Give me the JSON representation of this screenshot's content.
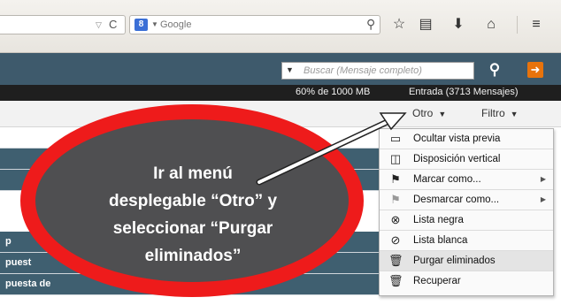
{
  "browser": {
    "search_placeholder": "Google",
    "search_engine_badge": "8",
    "icons": [
      "reload-icon",
      "search-icon",
      "star-icon",
      "reading-list-icon",
      "download-icon",
      "home-icon",
      "menu-icon"
    ]
  },
  "header": {
    "search_placeholder": "Buscar (Mensaje completo)"
  },
  "status": {
    "quota": "60% de 1000 MB",
    "folder": "Entrada (3713 Mensajes)"
  },
  "actions": {
    "otro": "Otro",
    "filtro": "Filtro"
  },
  "list": {
    "rows": [
      {
        "text": ""
      },
      {
        "text": ""
      },
      {
        "text": ""
      },
      {
        "text": "p"
      },
      {
        "text": "puest"
      },
      {
        "text": "puesta de"
      }
    ]
  },
  "menu": {
    "items": [
      {
        "label": "Ocultar vista previa",
        "icon": "preview-icon"
      },
      {
        "label": "Disposición vertical",
        "icon": "layout-icon"
      },
      {
        "label": "Marcar como...",
        "icon": "flag-icon",
        "submenu": true
      },
      {
        "label": "Desmarcar como...",
        "icon": "flag-outline-icon",
        "submenu": true
      },
      {
        "label": "Lista negra",
        "icon": "blacklist-icon"
      },
      {
        "label": "Lista blanca",
        "icon": "whitelist-icon"
      },
      {
        "label": "Purgar eliminados",
        "icon": "trash-icon",
        "highlighted": true
      },
      {
        "label": "Recuperar",
        "icon": "trash-icon"
      }
    ]
  },
  "callout": {
    "line1": "Ir al menú",
    "line2": "desplegable “Otro” y",
    "line3": "seleccionar “Purgar",
    "line4": "eliminados”"
  },
  "colors": {
    "header": "#3e5a6c",
    "callout_border": "#ee1b1b",
    "callout_fill": "#4f4f51",
    "logout": "#e8730c"
  }
}
